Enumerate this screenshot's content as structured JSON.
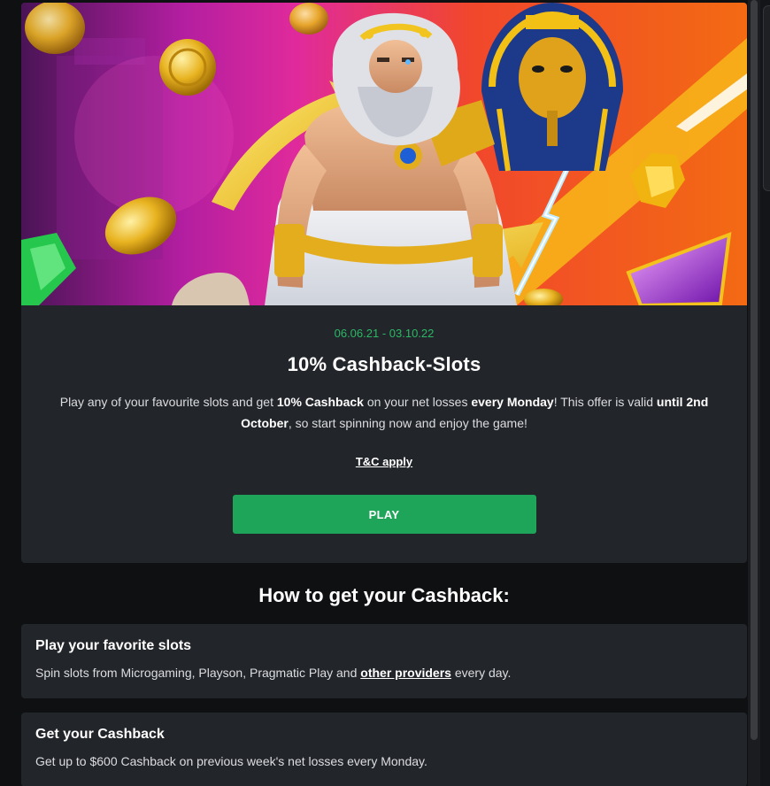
{
  "promo": {
    "dates": "06.06.21 - 03.10.22",
    "title": "10% Cashback-Slots",
    "description": {
      "p1": "Play any of your favourite slots and get ",
      "b1": "10% Cashback",
      "p2": " on your net losses ",
      "b2": "every Monday",
      "p3": "! This offer is valid ",
      "b3": "until 2nd October",
      "p4": ", so start spinning now and enjoy the game!"
    },
    "tc_label": "T&C apply",
    "play_label": "PLAY"
  },
  "howto": {
    "title": "How to get your Cashback:",
    "steps": [
      {
        "title": "Play your favorite slots",
        "text_before": "Spin slots from Microgaming, Playson, Pragmatic Play and ",
        "link": "other providers",
        "text_after": " every day."
      },
      {
        "title": "Get your Cashback",
        "text_before": "Get up to $600 Cashback on previous week's net losses every Monday.",
        "link": "",
        "text_after": ""
      }
    ]
  },
  "colors": {
    "accent_green": "#1fa55a",
    "date_green": "#2bb866",
    "card_bg": "#22252a",
    "page_bg": "#0f1012"
  },
  "icons": [
    "zeus-character-art",
    "pharaoh-character-art",
    "gold-coin-icon",
    "gem-icon",
    "lightning-bolt-art"
  ]
}
